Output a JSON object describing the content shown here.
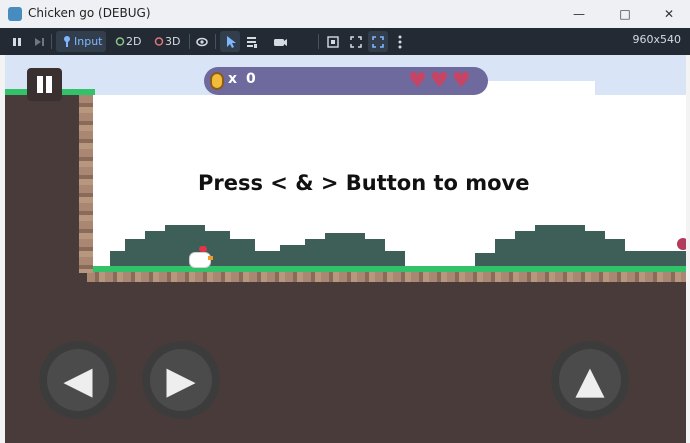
{
  "window": {
    "title": "Chicken go (DEBUG)",
    "minimize_glyph": "—",
    "maximize_glyph": "□",
    "close_glyph": "✕"
  },
  "toolbar": {
    "input_label": "Input",
    "mode_2d_label": "2D",
    "mode_3d_label": "3D",
    "resolution": "960x540"
  },
  "icons": {
    "suspend": "pause-icon",
    "next_frame": "next-frame-icon",
    "input": "joystick-icon",
    "visibility": "eye-icon",
    "select": "cursor-icon",
    "list": "list-icon",
    "camera": "camera-icon",
    "fit": "fit-icon",
    "expand": "expand-icon",
    "fullscreen": "fullscreen-icon",
    "more": "more-icon"
  },
  "colors": {
    "accent": "#7fb7ff",
    "toolbar_bg": "#232a33",
    "ground": "#4a3b3b",
    "grass": "#32c26a",
    "hud": "#6f6a9e",
    "heart": "#c44566"
  },
  "hud": {
    "coin_multiplier": "x",
    "coin_count": "0",
    "hearts": 3
  },
  "game": {
    "message": "Press < & > Button to move"
  },
  "controls": {
    "left_glyph": "◀",
    "right_glyph": "▶",
    "jump_glyph": "▲"
  }
}
